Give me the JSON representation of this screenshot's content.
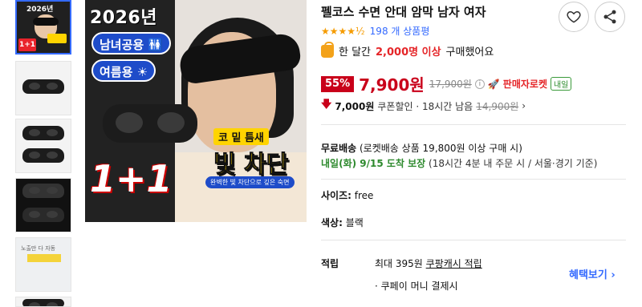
{
  "product": {
    "title": "펠코스 수면 안대 암막 남자 여자",
    "rating_stars": "★★★★½",
    "review_count": "198 개 상품평",
    "bought_prefix": "한 달간",
    "bought_count": "2,000명 이상",
    "bought_suffix": "구매했어요"
  },
  "thumbnails": {
    "t1_year": "2026년",
    "t1_badge": "1+1",
    "t5_text": "노출만 다 자동"
  },
  "main_image": {
    "year": "2026년",
    "pill1": "남녀공용 🚻",
    "pill2": "여름용 ☀",
    "oneone": "1+1",
    "tag1": "코 밑 틈새",
    "tag2": "빛 차단",
    "tag3": "완벽한 빛 차단으로 깊은 숙면"
  },
  "price": {
    "discount": "55%",
    "sale": "7,900원",
    "original": "17,900원",
    "info": "i",
    "seller_rocket": "판매자로켓",
    "same_day": "내일"
  },
  "coupon": {
    "arrow": "🡇",
    "amount": "7,000원",
    "text": "쿠폰할인 · 18시간 남음",
    "strike": "14,900원",
    "chevron": "›"
  },
  "shipping": {
    "free_label": "무료배송",
    "free_note": "(로켓배송 상품 19,800원 이상 구매 시)",
    "arrival": "내일(화) 9/15 도착 보장",
    "arrival_note": "(18시간 4분 내 주문 시 / 서울·경기 기준)"
  },
  "options": {
    "size_label": "사이즈:",
    "size_value": "free",
    "color_label": "색상:",
    "color_value": "블랙"
  },
  "benefits": {
    "label": "적립",
    "line1_prefix": "최대 395원",
    "line1_link": "쿠팡캐시 적립",
    "line2": "· 쿠페이 머니 결제시",
    "more": "혜택보기 ›"
  }
}
